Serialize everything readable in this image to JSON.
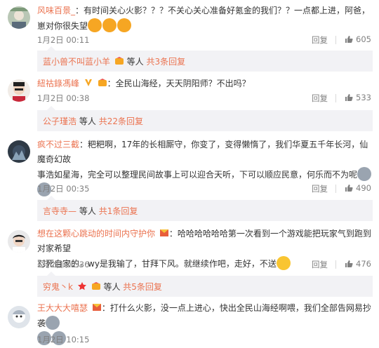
{
  "comments": [
    {
      "user": "风味百景_",
      "text": "：有时间关心火影？？？不关心关心准备好氪金的我们？？一点都上进，阿爸，崽对你很失望",
      "time": "1月2日 00:11",
      "reply": "回复",
      "likes": "605",
      "emojis": [
        "angry-emoji",
        "angry-emoji",
        "angry-emoji"
      ]
    },
    {
      "user": "紐祜錄馮峰",
      "text": "：全民山海经，天天阴阳师？不出吗？",
      "time": "1月2日 00:38",
      "reply": "回复",
      "likes": "533"
    },
    {
      "user": "疯不过三截",
      "text_line1": "：粑粑啊，17年的长相厮守，你变了，变得懒惰了，我们华夏五千年长河，仙魔奇幻故",
      "text_line2": "事浩如星海，完全可以整理民间故事上可以迎合天听，下可以顺应民意，何乐而不为呢",
      "time": "1月2日 00:35",
      "reply": "回复",
      "likes": "490",
      "emojis": [
        "husky-emoji",
        "husky-emoji"
      ]
    },
    {
      "user": "想在这颗心跳动的时间内守护你",
      "text_line1": "：哈哈哈哈哈哈第一次看到一个游戏能把玩家气到跑到对家希望",
      "text_line2": "怼死自家的。wy是我输了，甘拜下风。就继续作吧，走好，不送",
      "time": "1月2日 02:36",
      "reply": "回复",
      "likes": "476"
    },
    {
      "user": "王大大大嘻瑟",
      "text": "：打什么火影，没一点上进心，快出全民山海经啊喂，我们全部告网易抄袭",
      "time": "1月2日 10:15",
      "emojis": [
        "husky-emoji",
        "husky-emoji",
        "husky-emoji"
      ]
    }
  ],
  "subs": [
    {
      "user": "蓝小兽不叫蓝小羊",
      "etc": "等人",
      "count": "共3条回复"
    },
    {
      "user": "公子瑾浩",
      "etc": "等人",
      "count": "共22条回复"
    },
    {
      "user": "言寺寺—",
      "etc": "等人",
      "count": "共1条回复"
    },
    {
      "user": "穷鬼丶k",
      "etc": "等人",
      "count": "共5条回复"
    }
  ],
  "colors": {
    "username": "#eb7350",
    "meta": "#808080",
    "reply_bg": "#f2f2f5"
  }
}
